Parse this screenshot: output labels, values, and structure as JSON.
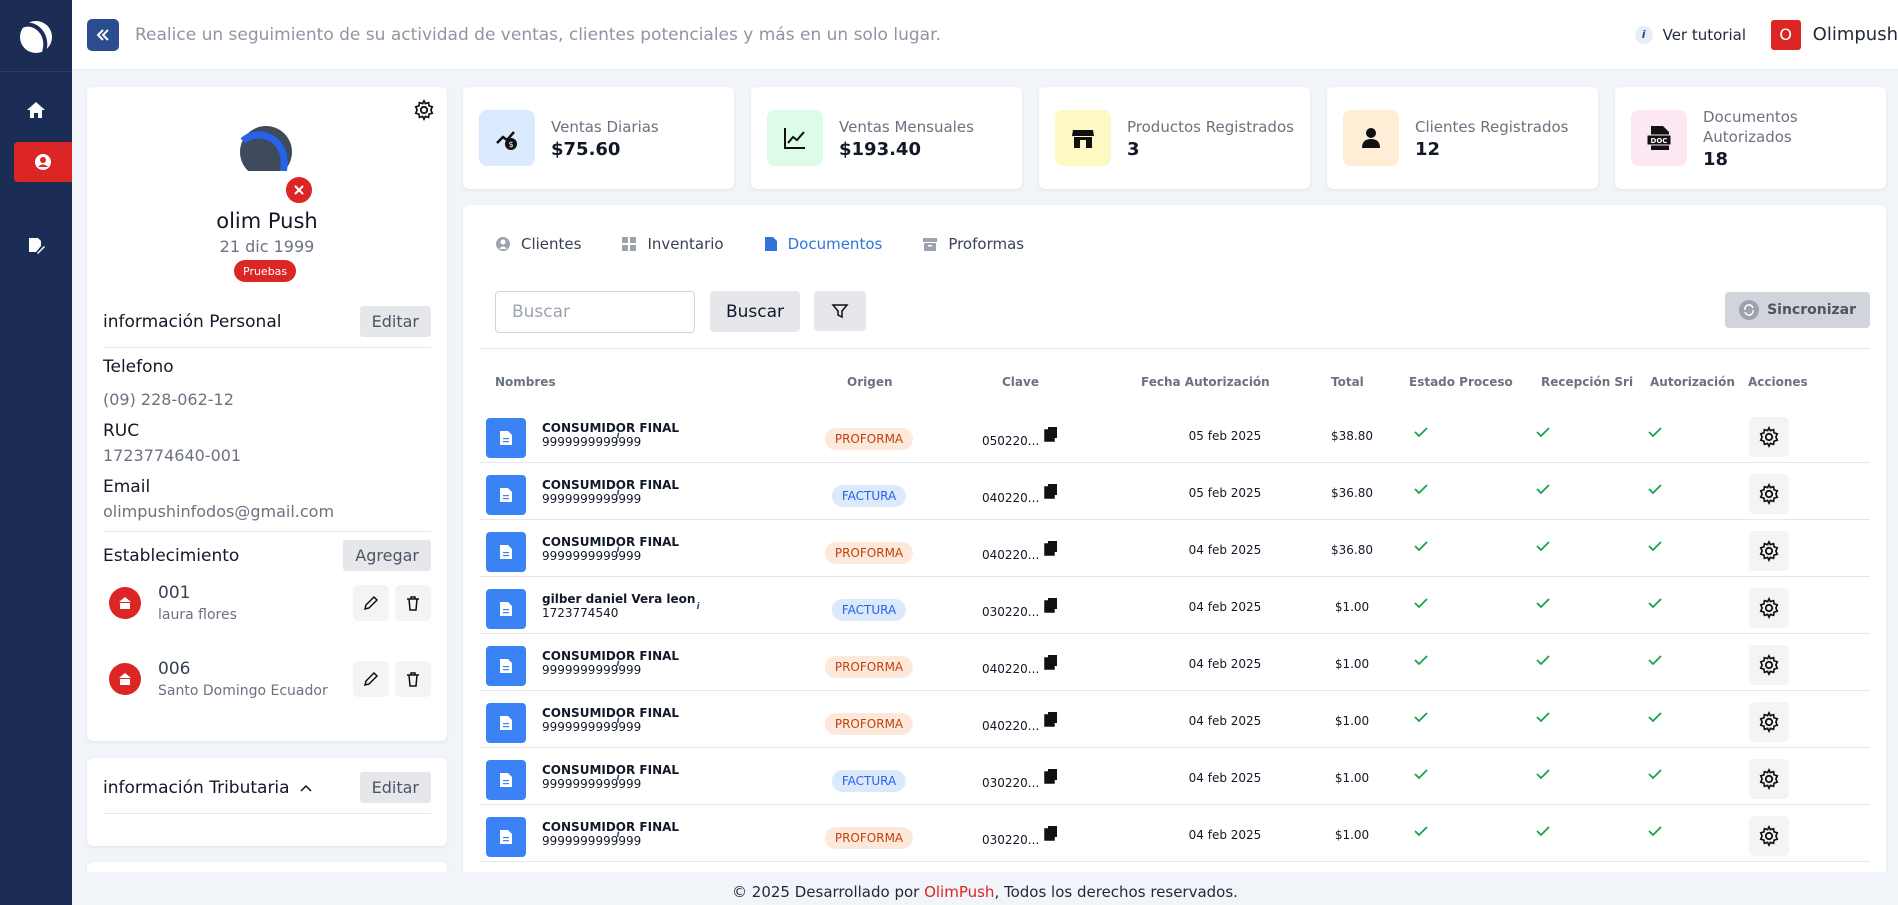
{
  "topbar": {
    "tagline": "Realice un seguimiento de su actividad de ventas, clientes potenciales y más en un solo lugar.",
    "tutorial_label": "Ver tutorial",
    "user_initial": "O",
    "user_name": "Olimpush"
  },
  "sidebar": {
    "items": [
      {
        "name": "home",
        "icon": "home-icon"
      },
      {
        "name": "profile",
        "icon": "user-icon",
        "active": true
      },
      {
        "name": "documents",
        "icon": "document-edit-icon"
      }
    ]
  },
  "profile": {
    "name": "olim Push",
    "date": "21 dic 1999",
    "badge": "Pruebas",
    "personal_title": "información Personal",
    "edit_label": "Editar",
    "phone_label": "Telefono",
    "phone": "(09) 228-062-12",
    "ruc_label": "RUC",
    "ruc": "1723774640-001",
    "email_label": "Email",
    "email": "olimpushinfodos@gmail.com",
    "establishment_title": "Establecimiento",
    "add_label": "Agregar",
    "establishments": [
      {
        "code": "001",
        "address": "laura flores"
      },
      {
        "code": "006",
        "address": "Santo Domingo Ecuador"
      }
    ],
    "tax_title": "información Tributaria",
    "tax_edit_label": "Editar"
  },
  "stats": [
    {
      "label": "Ventas Diarias",
      "value": "$75.60",
      "bg": "#dbeafe",
      "icon": "money-chart-icon"
    },
    {
      "label": "Ventas Mensuales",
      "value": "$193.40",
      "bg": "#dcfce7",
      "icon": "line-chart-icon"
    },
    {
      "label": "Productos Registrados",
      "value": "3",
      "bg": "#fef9c3",
      "icon": "store-icon"
    },
    {
      "label": "Clientes Registrados",
      "value": "12",
      "bg": "#ffedd5",
      "icon": "person-icon"
    },
    {
      "label": "Documentos Autorizados",
      "value": "18",
      "bg": "#fce7f3",
      "icon": "doc-icon"
    }
  ],
  "tabs": [
    {
      "label": "Clientes",
      "icon": "user-circle-icon"
    },
    {
      "label": "Inventario",
      "icon": "grid-icon"
    },
    {
      "label": "Documentos",
      "icon": "file-icon",
      "active": true
    },
    {
      "label": "Proformas",
      "icon": "archive-icon"
    }
  ],
  "toolbar": {
    "search_placeholder": "Buscar",
    "search_button": "Buscar",
    "sync_button": "Sincronizar"
  },
  "table": {
    "headers": [
      "Nombres",
      "Origen",
      "Clave",
      "Fecha Autorización",
      "Total",
      "Estado Proceso",
      "Recepción Sri",
      "Autorización",
      "Acciones"
    ],
    "rows": [
      {
        "name": "CONSUMIDOR FINAL",
        "id": "9999999999999",
        "origin": "PROFORMA",
        "clave": "050220...",
        "fecha": "05 feb 2025",
        "total": "$38.80"
      },
      {
        "name": "CONSUMIDOR FINAL",
        "id": "9999999999999",
        "origin": "FACTURA",
        "clave": "040220...",
        "fecha": "05 feb 2025",
        "total": "$36.80"
      },
      {
        "name": "CONSUMIDOR FINAL",
        "id": "9999999999999",
        "origin": "PROFORMA",
        "clave": "040220...",
        "fecha": "04 feb 2025",
        "total": "$36.80"
      },
      {
        "name": "gilber daniel Vera leon",
        "id": "1723774540",
        "origin": "FACTURA",
        "clave": "030220...",
        "fecha": "04 feb 2025",
        "total": "$1.00"
      },
      {
        "name": "CONSUMIDOR FINAL",
        "id": "9999999999999",
        "origin": "PROFORMA",
        "clave": "040220...",
        "fecha": "04 feb 2025",
        "total": "$1.00"
      },
      {
        "name": "CONSUMIDOR FINAL",
        "id": "9999999999999",
        "origin": "PROFORMA",
        "clave": "040220...",
        "fecha": "04 feb 2025",
        "total": "$1.00"
      },
      {
        "name": "CONSUMIDOR FINAL",
        "id": "9999999999999",
        "origin": "FACTURA",
        "clave": "030220...",
        "fecha": "04 feb 2025",
        "total": "$1.00"
      },
      {
        "name": "CONSUMIDOR FINAL",
        "id": "9999999999999",
        "origin": "PROFORMA",
        "clave": "030220...",
        "fecha": "04 feb 2025",
        "total": "$1.00"
      }
    ]
  },
  "footer": {
    "prefix": "© 2025 Desarrollado por ",
    "brand": "OlimPush",
    "suffix": ", Todos los derechos reservados."
  },
  "colors": {
    "sidebar": "#1c2d55",
    "accent": "#dc2626",
    "primary": "#2f74d9",
    "check": "#16a34a"
  }
}
